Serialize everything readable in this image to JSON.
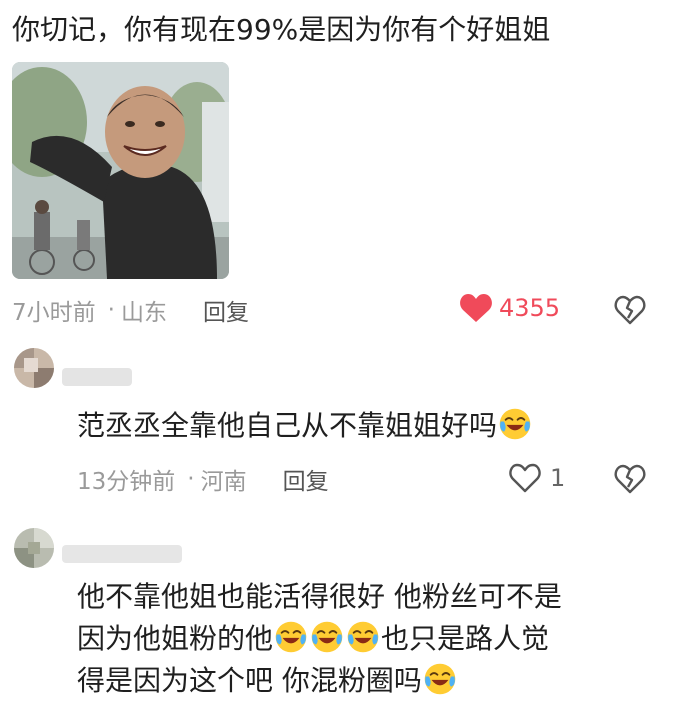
{
  "post": {
    "text": "你切记，你有现在99%是因为你有个好姐姐",
    "time": "7小时前",
    "location": "山东",
    "reply_label": "回复",
    "like_count": "4355"
  },
  "replies": [
    {
      "text": "范丞丞全靠他自己从不靠姐姐好吗",
      "time": "13分钟前",
      "location": "河南",
      "reply_label": "回复",
      "like_count": "1"
    },
    {
      "line1": "他不靠他姐也能活得很好 他粉丝可不是",
      "line2_a": "因为他姐粉的他",
      "line2_b": "也只是路人觉",
      "line3": "得是因为这个吧 你混粉圈吗"
    }
  ],
  "icons": {
    "like_filled": "heart-filled-icon",
    "like_outline": "heart-outline-icon",
    "dislike": "broken-heart-icon",
    "emoji": "tears-of-joy-emoji"
  },
  "colors": {
    "like_red": "#f04a5a",
    "meta_grey": "#9a9a9a"
  }
}
